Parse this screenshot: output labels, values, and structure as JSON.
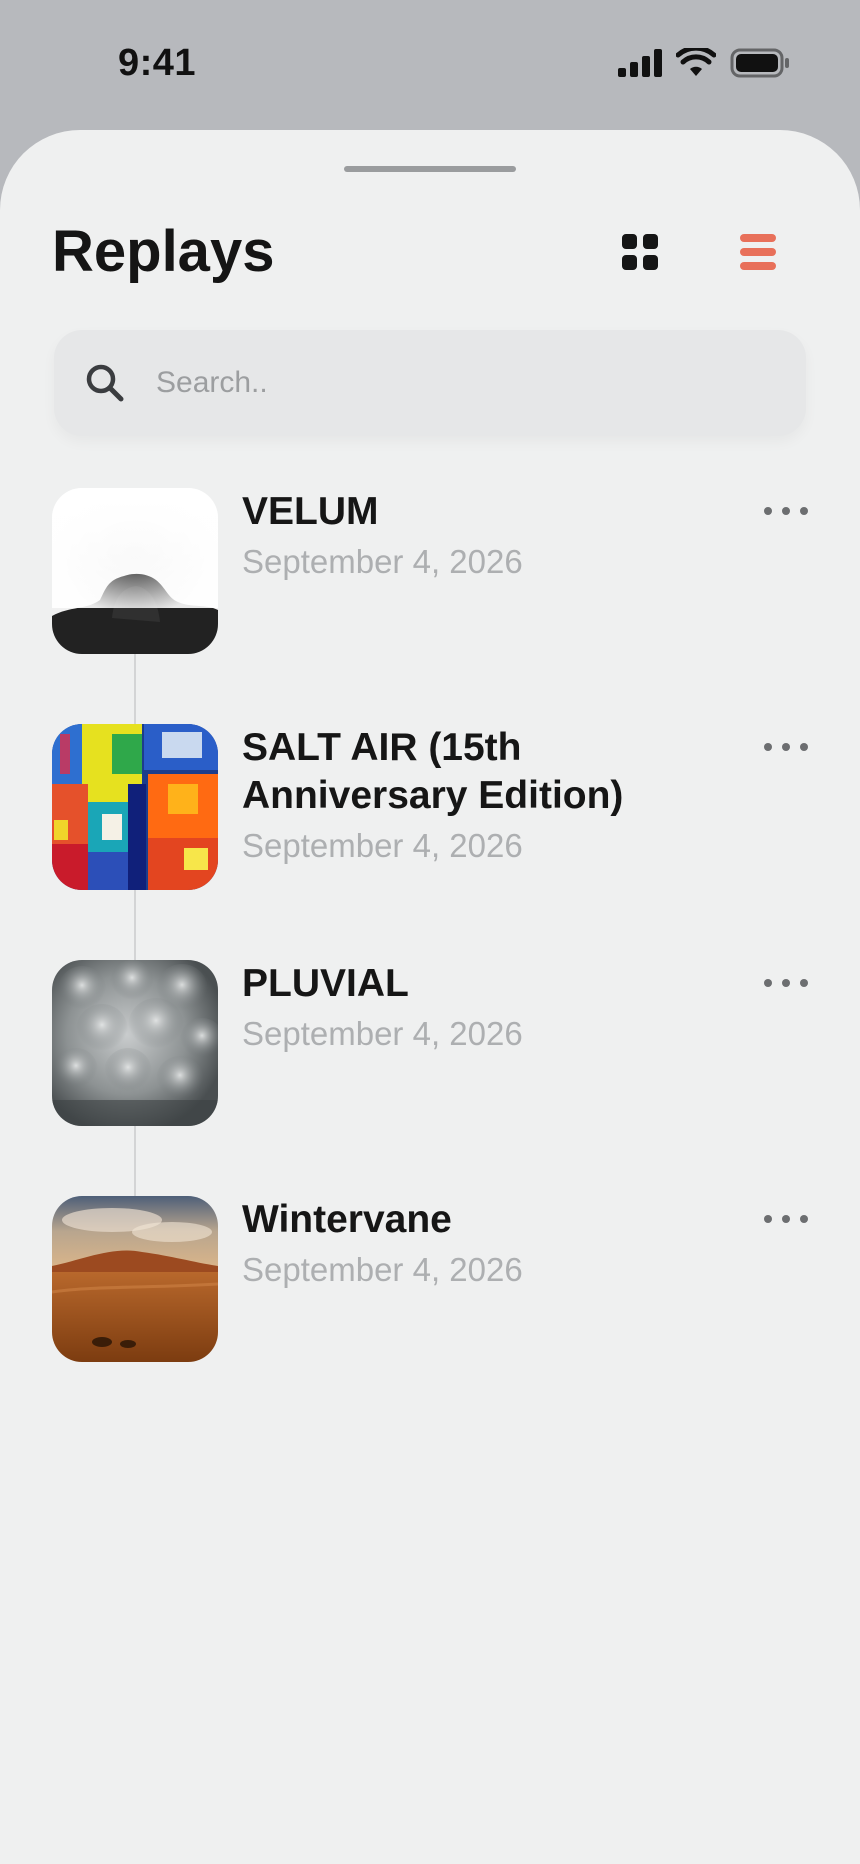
{
  "status_bar": {
    "time": "9:41",
    "icons": [
      "cellular-signal-icon",
      "wifi-icon",
      "battery-icon"
    ]
  },
  "header": {
    "title": "Replays",
    "grid_view_icon": "grid-icon",
    "list_view_icon": "list-icon",
    "active_view": "list"
  },
  "search": {
    "icon": "search-icon",
    "placeholder": "Search..",
    "value": ""
  },
  "replays": [
    {
      "title": "VELUM",
      "date": "September 4, 2026",
      "artwork": "misty-rock-artwork"
    },
    {
      "title": "SALT AIR (15th Anniversary Edition)",
      "date": "September 4, 2026",
      "artwork": "abstract-paint-artwork"
    },
    {
      "title": "PLUVIAL",
      "date": "September 4, 2026",
      "artwork": "storm-clouds-artwork"
    },
    {
      "title": "Wintervane",
      "date": "September 4, 2026",
      "artwork": "desert-dunes-artwork"
    }
  ],
  "colors": {
    "accent": "#e8705a",
    "background": "#eff0f0",
    "status_bar_bg": "#b7b9bd",
    "date_text": "#adafb1"
  }
}
